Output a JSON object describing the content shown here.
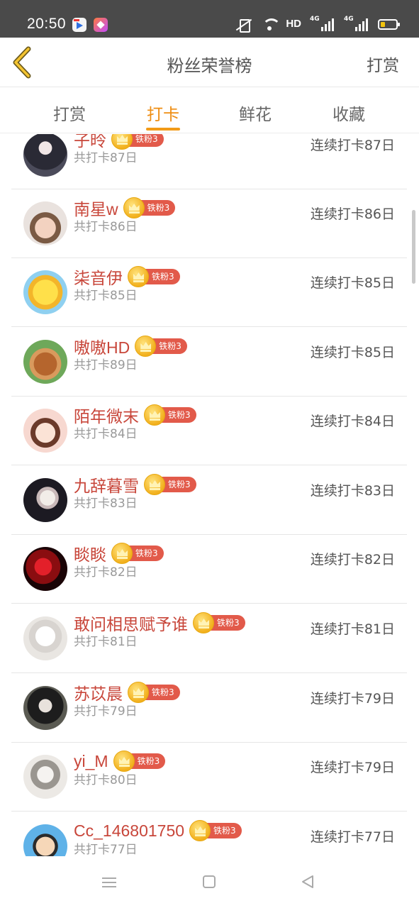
{
  "status_bar": {
    "time": "20:50",
    "hd_label": "HD",
    "net1": "4G",
    "net2": "4G"
  },
  "header": {
    "title": "粉丝荣誉榜",
    "action": "打赏"
  },
  "tabs": [
    {
      "label": "打赏",
      "active": false
    },
    {
      "label": "打卡",
      "active": true
    },
    {
      "label": "鲜花",
      "active": false
    },
    {
      "label": "收藏",
      "active": false
    }
  ],
  "fans": [
    {
      "name": "子昤",
      "badge": "铁粉3",
      "total": "共打卡87日",
      "streak": "连续打卡87日"
    },
    {
      "name": "南星w",
      "badge": "铁粉3",
      "total": "共打卡86日",
      "streak": "连续打卡86日"
    },
    {
      "name": "柒音伊",
      "badge": "铁粉3",
      "total": "共打卡85日",
      "streak": "连续打卡85日"
    },
    {
      "name": "嗷嗷HD",
      "badge": "铁粉3",
      "total": "共打卡89日",
      "streak": "连续打卡85日"
    },
    {
      "name": "陌年微末",
      "badge": "铁粉3",
      "total": "共打卡84日",
      "streak": "连续打卡84日"
    },
    {
      "name": "九辞暮雪",
      "badge": "铁粉3",
      "total": "共打卡83日",
      "streak": "连续打卡83日"
    },
    {
      "name": "睒睒",
      "badge": "铁粉3",
      "total": "共打卡82日",
      "streak": "连续打卡82日"
    },
    {
      "name": "敢问相思赋予谁",
      "badge": "铁粉3",
      "total": "共打卡81日",
      "streak": "连续打卡81日"
    },
    {
      "name": "苏苡晨",
      "badge": "铁粉3",
      "total": "共打卡79日",
      "streak": "连续打卡79日"
    },
    {
      "name": "yi_M",
      "badge": "铁粉3",
      "total": "共打卡80日",
      "streak": "连续打卡79日"
    },
    {
      "name": "Cc_146801750",
      "badge": "铁粉3",
      "total": "共打卡77日",
      "streak": "连续打卡77日"
    }
  ],
  "colors": {
    "accent": "#ee8d12",
    "name": "#c8463a",
    "badge": "#e25a4a"
  }
}
